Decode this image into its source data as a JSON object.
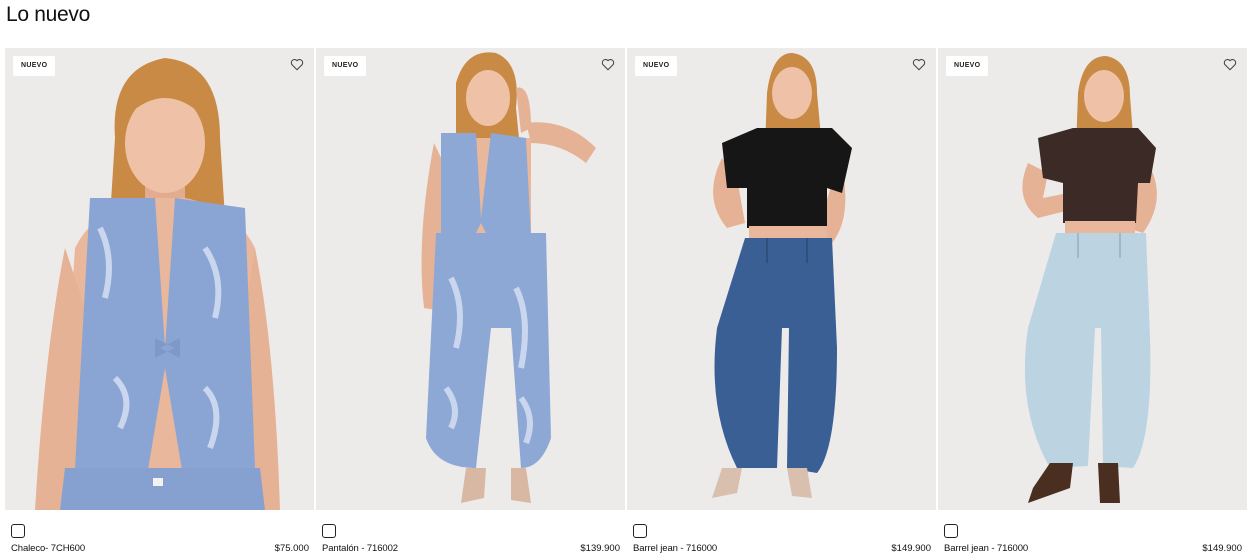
{
  "section": {
    "title": "Lo nuevo"
  },
  "products": [
    {
      "badge": "NUEVO",
      "name": "Chaleco- 7CH600",
      "price": "$75.000",
      "image": "model-floral-denim-vest-closeup",
      "colors": {
        "top": "#8aa5d3",
        "bottom": "#8aa5d3"
      }
    },
    {
      "badge": "NUEVO",
      "name": "Pantalón - 716002",
      "price": "$139.900",
      "image": "model-floral-denim-set-full",
      "colors": {
        "top": "#8ea8d5",
        "bottom": "#8ea8d5"
      }
    },
    {
      "badge": "NUEVO",
      "name": "Barrel jean - 716000",
      "price": "$149.900",
      "image": "model-black-top-dark-barrel-jean",
      "colors": {
        "top": "#161616",
        "bottom": "#3a5f95"
      }
    },
    {
      "badge": "NUEVO",
      "name": "Barrel jean - 716000",
      "price": "$149.900",
      "image": "model-brown-top-light-barrel-jean",
      "colors": {
        "top": "#3b2a26",
        "bottom": "#bcd3e2"
      }
    }
  ],
  "icons": {
    "favorite": "heart-outline-icon",
    "color_swatch": "square-swatch-icon"
  },
  "palette": {
    "photo_background": "#ecebea",
    "skin": "#e9b79b",
    "hair": "#c98a45"
  }
}
